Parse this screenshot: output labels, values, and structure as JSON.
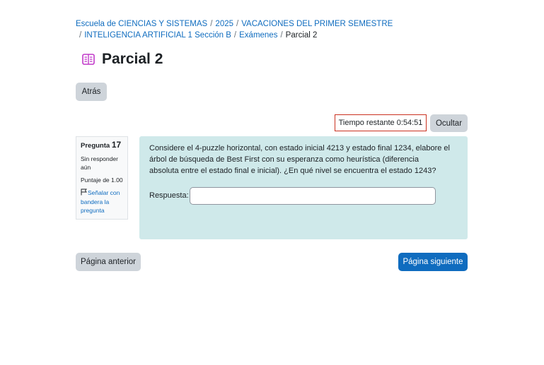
{
  "breadcrumb": {
    "items": [
      "Escuela de CIENCIAS Y SISTEMAS",
      "2025",
      "VACACIONES DEL PRIMER SEMESTRE",
      "INTELIGENCIA ARTIFICIAL 1 Sección B",
      "Exámenes"
    ],
    "current": "Parcial 2",
    "separator": "/"
  },
  "page": {
    "title": "Parcial 2",
    "icon": "quiz-icon",
    "accent_color": "#c13ac9"
  },
  "nav": {
    "back_label": "Atrás",
    "prev_label": "Página anterior",
    "next_label": "Página siguiente"
  },
  "timer": {
    "text": "Tiempo restante 0:54:51",
    "hide_label": "Ocultar"
  },
  "question": {
    "label": "Pregunta",
    "number": "17",
    "status": "Sin responder aún",
    "mark": "Puntaje de 1.00",
    "flag_label": "Señalar con bandera la pregunta",
    "text": "Considere el 4-puzzle horizontal, con estado inicial 4213 y estado final 1234, elabore el árbol de búsqueda de Best First con su esperanza como heurística (diferencia absoluta entre el estado final e inicial). ¿En qué nivel se encuentra el estado 1243?",
    "answer_label": "Respuesta:",
    "answer_value": ""
  },
  "colors": {
    "primary": "#0f6cbf",
    "secondary_button": "#ced4da",
    "question_bg": "#cfe9ea",
    "timer_border": "#ca3120"
  }
}
